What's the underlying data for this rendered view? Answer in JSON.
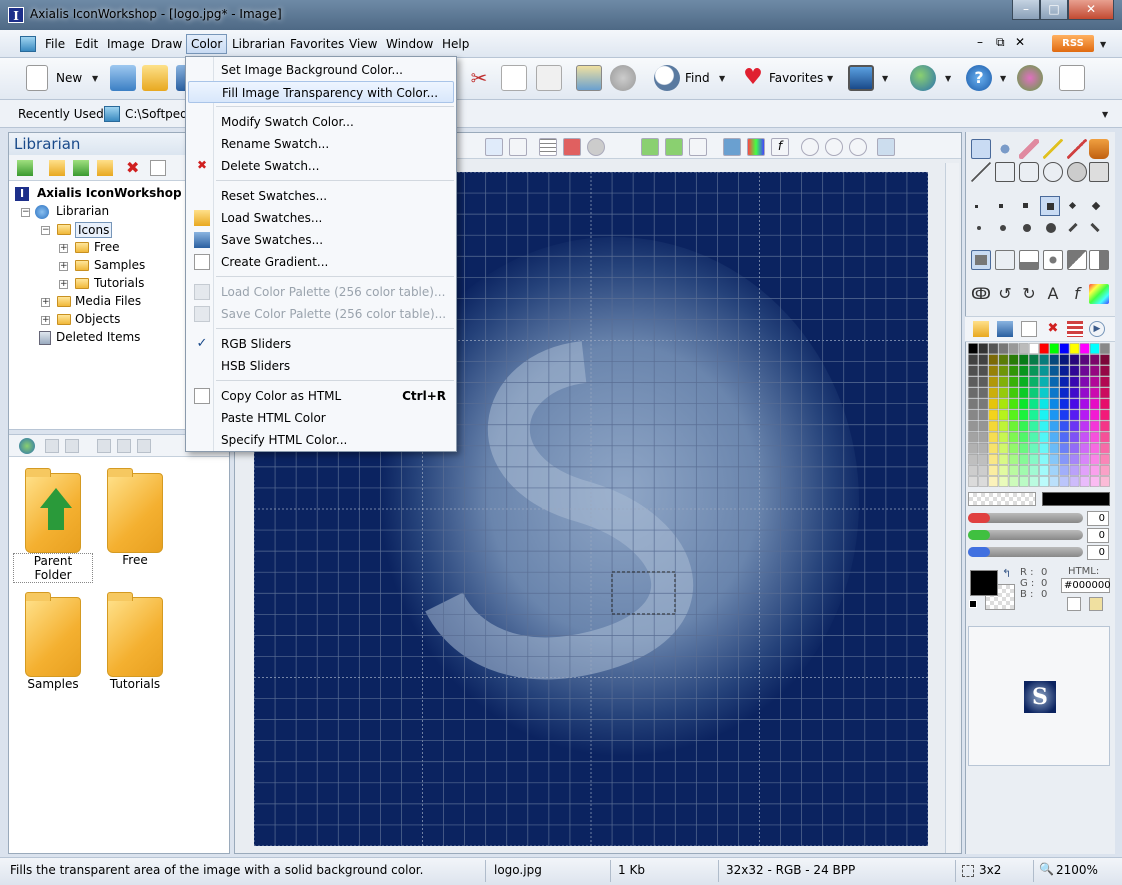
{
  "window": {
    "title": "Axialis IconWorkshop - [logo.jpg* - Image]"
  },
  "menubar": {
    "items": [
      "File",
      "Edit",
      "Image",
      "Draw",
      "Color",
      "Librarian",
      "Favorites",
      "View",
      "Window",
      "Help"
    ],
    "rss": "RSS"
  },
  "toolbar": {
    "new_label": "New",
    "find_label": "Find",
    "favorites_label": "Favorites"
  },
  "recent": {
    "label": "Recently Used",
    "path": "C:\\Softpedi"
  },
  "librarian": {
    "title": "Librarian",
    "tree": [
      "Axialis IconWorkshop",
      "Librarian",
      "Icons",
      "Free",
      "Samples",
      "Tutorials",
      "Media Files",
      "Objects",
      "Deleted Items"
    ],
    "thumbs": [
      "Parent Folder",
      "Free",
      "Samples",
      "Tutorials"
    ]
  },
  "color_menu": {
    "items": [
      {
        "label": "Set Image Background Color...",
        "key": "",
        "state": "normal"
      },
      {
        "label": "Fill Image Transparency with Color...",
        "key": "",
        "state": "highlight"
      },
      {
        "label": "Modify Swatch Color...",
        "key": "",
        "state": "normal"
      },
      {
        "label": "Rename Swatch...",
        "key": "",
        "state": "normal"
      },
      {
        "label": "Delete Swatch...",
        "key": "",
        "state": "normal"
      },
      {
        "label": "Reset Swatches...",
        "key": "",
        "state": "normal"
      },
      {
        "label": "Load Swatches...",
        "key": "",
        "state": "normal"
      },
      {
        "label": "Save Swatches...",
        "key": "",
        "state": "normal"
      },
      {
        "label": "Create Gradient...",
        "key": "",
        "state": "normal"
      },
      {
        "label": "Load Color Palette (256 color table)...",
        "key": "",
        "state": "disabled"
      },
      {
        "label": "Save Color Palette (256 color table)...",
        "key": "",
        "state": "disabled"
      },
      {
        "label": "RGB Sliders",
        "key": "",
        "state": "checked"
      },
      {
        "label": "HSB Sliders",
        "key": "",
        "state": "normal"
      },
      {
        "label": "Copy Color as HTML",
        "key": "Ctrl+R",
        "state": "normal"
      },
      {
        "label": "Paste HTML Color",
        "key": "",
        "state": "normal"
      },
      {
        "label": "Specify HTML Color...",
        "key": "",
        "state": "normal"
      }
    ]
  },
  "color_panel": {
    "slider_values": [
      "0",
      "0",
      "0"
    ],
    "r_label": "R :",
    "g_label": "G :",
    "b_label": "B :",
    "r": "0",
    "g": "0",
    "b": "0",
    "html_label": "HTML:",
    "html_value": "#000000",
    "preview_letter": "S"
  },
  "statusbar": {
    "hint": "Fills the transparent area of the image with a solid background color.",
    "file": "logo.jpg",
    "size": "1 Kb",
    "format": "32x32 - RGB - 24 BPP",
    "selection": "3x2",
    "zoom": "2100%"
  },
  "colors": {
    "canvas_bg": "#0b2360",
    "menu_highlight": "#d8e7fb"
  }
}
